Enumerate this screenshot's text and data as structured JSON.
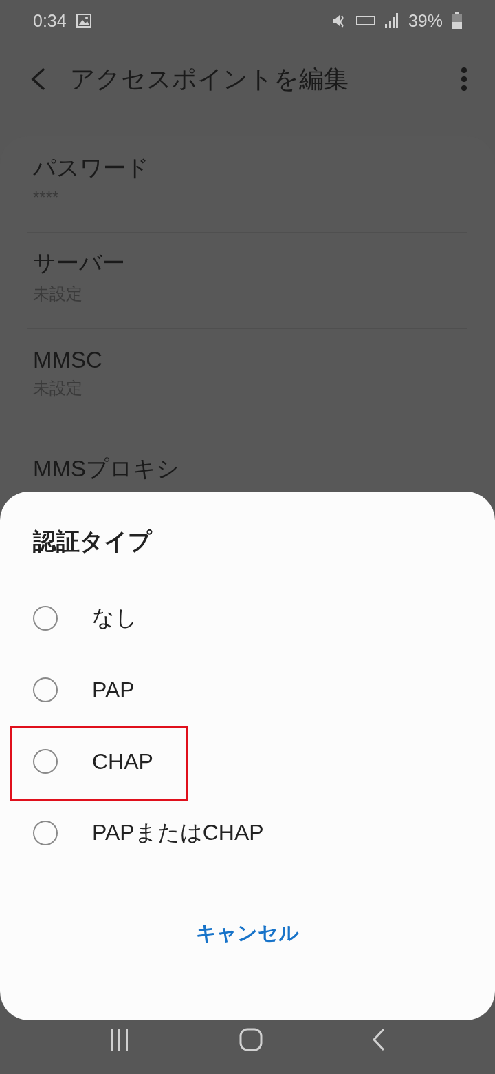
{
  "status_bar": {
    "time": "0:34",
    "battery": "39%"
  },
  "toolbar": {
    "title": "アクセスポイントを編集"
  },
  "settings": [
    {
      "title": "パスワード",
      "value": "****"
    },
    {
      "title": "サーバー",
      "value": "未設定"
    },
    {
      "title": "MMSC",
      "value": "未設定"
    },
    {
      "title": "MMSプロキシ"
    }
  ],
  "dialog": {
    "title": "認証タイプ",
    "options": [
      {
        "label": "なし",
        "selected": false,
        "highlighted": false
      },
      {
        "label": "PAP",
        "selected": false,
        "highlighted": false
      },
      {
        "label": "CHAP",
        "selected": false,
        "highlighted": true
      },
      {
        "label": "PAPまたはCHAP",
        "selected": false,
        "highlighted": false
      }
    ],
    "cancel": "キャンセル"
  }
}
